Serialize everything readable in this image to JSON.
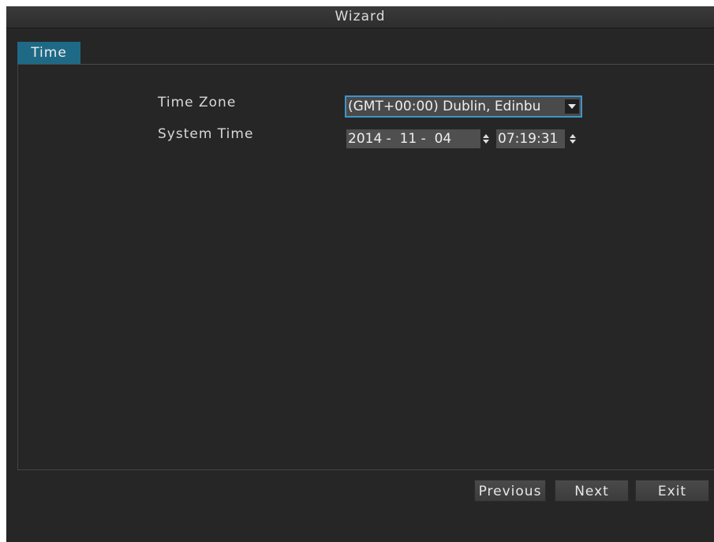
{
  "window": {
    "title": "Wizard"
  },
  "tabs": [
    {
      "label": "Time",
      "active": true
    }
  ],
  "form": {
    "time_zone_label": "Time Zone",
    "time_zone_value": "(GMT+00:00) Dublin, Edinbu",
    "system_time_label": "System Time",
    "date_value": "2014 -  11 -  04",
    "time_value": "07:19:31"
  },
  "buttons": {
    "previous": "Previous",
    "next": "Next",
    "exit": "Exit"
  },
  "icons": {
    "dropdown": "chevron-down-icon",
    "spinner": "up-down-arrows-icon"
  },
  "colors": {
    "background": "#262626",
    "tab_active": "#1e6a86",
    "focus_border": "#3d95c8",
    "button": "#424242"
  }
}
